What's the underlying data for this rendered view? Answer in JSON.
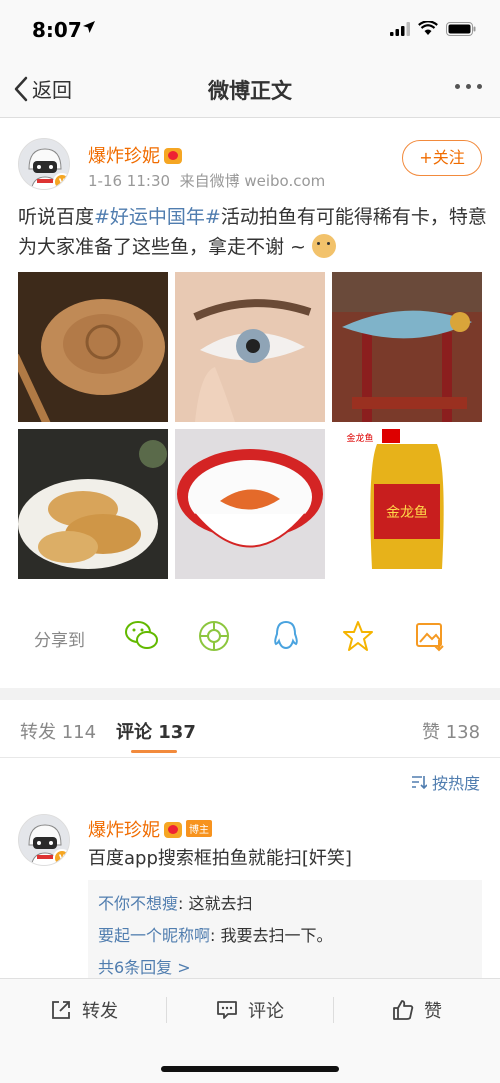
{
  "status_bar": {
    "time": "8:07"
  },
  "nav": {
    "back_label": "返回",
    "title": "微博正文"
  },
  "post": {
    "author": "爆炸珍妮",
    "date": "1-16 11:30",
    "source": "来自微博 weibo.com",
    "follow_label": "+关注",
    "text_prefix": "听说百度",
    "hashtag": "#好运中国年#",
    "text_suffix": "活动拍鱼有可能得稀有卡，特意为大家准备了这些鱼，拿走不谢 ~",
    "images": [
      {
        "name": "wooden-fish-image"
      },
      {
        "name": "eye-image"
      },
      {
        "name": "dragon-fish-carving-image"
      },
      {
        "name": "taiyaki-image"
      },
      {
        "name": "fish-bowl-image"
      },
      {
        "name": "jinlongyu-oil-image",
        "brand_text": "金龙鱼"
      }
    ],
    "share_label": "分享到"
  },
  "tabs": {
    "repost": "转发 114",
    "comment": "评论 137",
    "like": "赞 138"
  },
  "comments": {
    "sort_label": "按热度",
    "items": [
      {
        "author": "爆炸珍妮",
        "badge": "博主",
        "text": "百度app搜索框拍鱼就能扫[奸笑]",
        "replies": [
          {
            "who": "不你不想瘦",
            "text": ": 这就去扫"
          },
          {
            "who": "要起一个昵称啊",
            "text": ": 我要去扫一下。"
          }
        ],
        "more": "共6条回复 >"
      }
    ]
  },
  "bottom_bar": {
    "repost": "转发",
    "comment": "评论",
    "like": "赞"
  },
  "colors": {
    "accent": "#f06c00",
    "link": "#507daf",
    "tab_underline": "#f28a3c"
  }
}
